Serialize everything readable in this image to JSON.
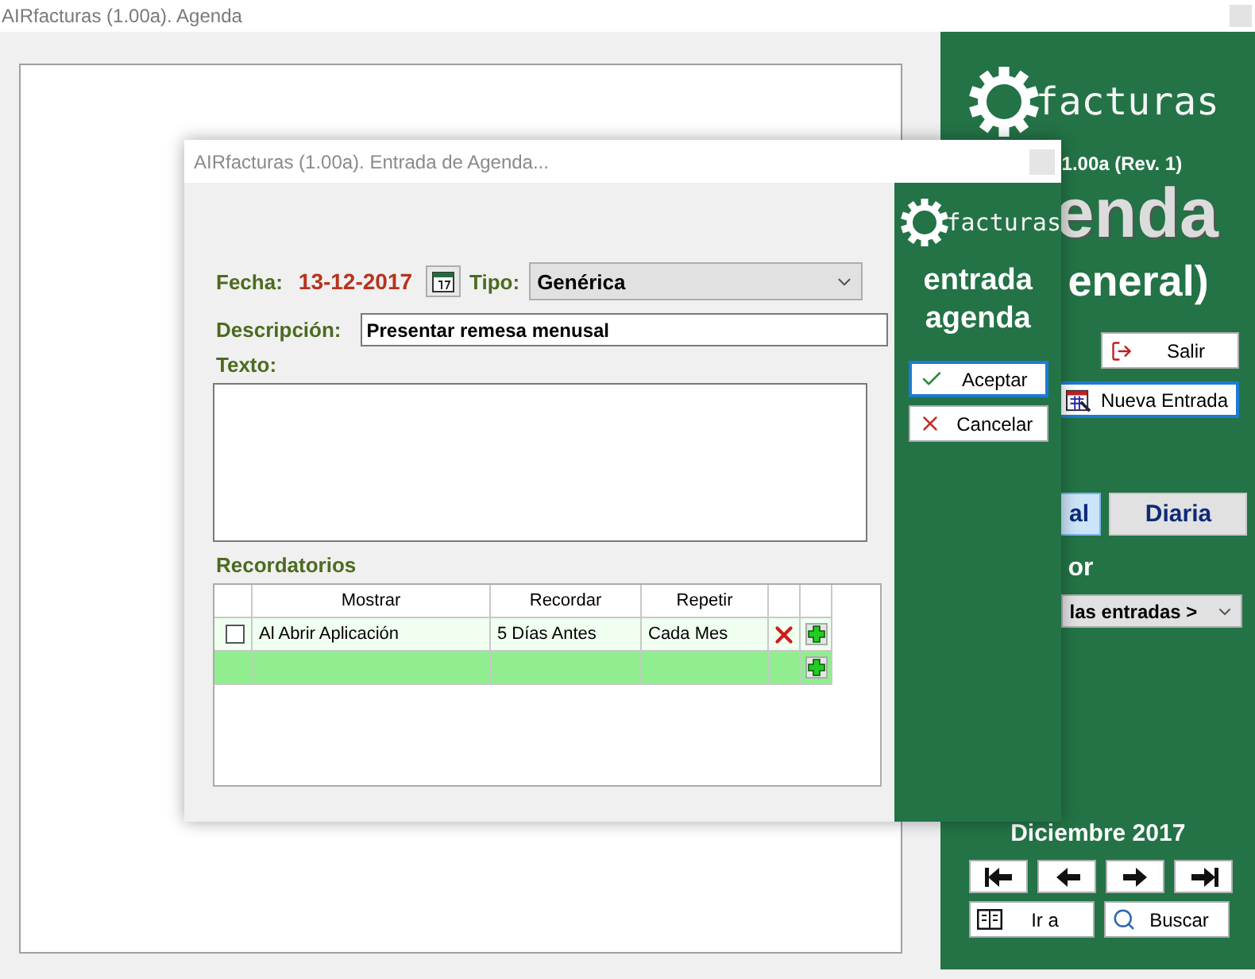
{
  "main_window": {
    "title": "AIRfacturas (1.00a). Agenda",
    "panel": {
      "logo_text": "facturas",
      "version": "1.00a (Rev. 1)",
      "title_fragment": "enda",
      "subtitle_fragment": "eneral)",
      "buttons": [
        {
          "label": "Salir",
          "kind": "exit",
          "focused": false
        },
        {
          "label": "Nueva Entrada",
          "kind": "new",
          "focused": true
        }
      ],
      "view_tabs": [
        {
          "label": "al",
          "selected": true
        },
        {
          "label": "Diaria",
          "selected": false
        }
      ],
      "filter_label": "or",
      "filter_value": "las entradas >",
      "month": "Diciembre 2017",
      "nav_buttons": [
        {
          "kind": "first"
        },
        {
          "kind": "previous"
        },
        {
          "kind": "next"
        },
        {
          "kind": "last"
        }
      ],
      "actions": [
        {
          "label": "Ir a",
          "kind": "goto"
        },
        {
          "label": "Buscar",
          "kind": "search"
        }
      ]
    }
  },
  "dialog": {
    "title": "AIRfacturas (1.00a). Entrada de Agenda...",
    "logo_text": "facturas",
    "heading": [
      "entrada",
      "agenda"
    ],
    "buttons": [
      {
        "label": "Aceptar",
        "kind": "accept",
        "focused": true
      },
      {
        "label": "Cancelar",
        "kind": "cancel",
        "focused": false
      }
    ],
    "form": {
      "date_label": "Fecha:",
      "date": "13-12-2017",
      "type_label": "Tipo:",
      "type_value": "Genérica",
      "description_label": "Descripción:",
      "description_value": "Presentar remesa menusal",
      "text_label": "Texto:",
      "reminders_label": "Recordatorios",
      "reminders": {
        "columns": [
          "Mostrar",
          "Recordar",
          "Repetir"
        ],
        "rows": [
          {
            "kind": "entry",
            "checked": false,
            "show": "Al Abrir Aplicación",
            "remind": "5 Días Antes",
            "repeat": "Cada Mes"
          },
          {
            "kind": "new"
          }
        ]
      }
    }
  }
}
